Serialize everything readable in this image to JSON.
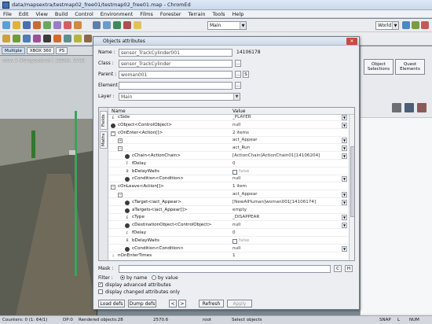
{
  "window": {
    "title": "data/mapsextra/testmap02_free01/testmap02_free01.map - ChromEd"
  },
  "menu": [
    "File",
    "Edit",
    "View",
    "Build",
    "Control",
    "Environment",
    "Films",
    "Forester",
    "Terrain",
    "Tools",
    "Help"
  ],
  "toolbar": {
    "main_combo": "Main",
    "world_combo": "World"
  },
  "platform_tabs": [
    "Multiple",
    "XBOX 360",
    "PS"
  ],
  "viewport": {
    "caption": "view 3 (Perspective) [ 29506, 5703"
  },
  "right_panel": {
    "object_selections": "Object Selections",
    "quest_elements": "Quest Elements"
  },
  "dialog": {
    "title": "Objects attributes",
    "name_label": "Name :",
    "name_value": "sensor_TrackCylinder001",
    "id_value": "14106178",
    "class_label": "Class :",
    "class_value": "sensor_TrackCylinder",
    "parent_label": "Parent :",
    "parent_value": "woman001",
    "parent_btn": "S",
    "element_label": "Element :",
    "layer_label": "Layer :",
    "layer_value": "Main",
    "vtab_fields": "Fields",
    "vtab_maths": "Maths",
    "col_name": "Name",
    "col_value": "Value",
    "rows": [
      {
        "icon": "E",
        "name": "cSide",
        "value": "_PLAYER",
        "dd": true,
        "indent": 0
      },
      {
        "icon": "obj",
        "name": "cObject<ControlObject>",
        "value": "null",
        "dd": true,
        "indent": 0
      },
      {
        "icon": "minus",
        "name": "cOnEnter<Action[]>",
        "value": "2 items",
        "dd": false,
        "indent": 0
      },
      {
        "icon": "plus",
        "name": "",
        "value": "act_Appear",
        "dd": true,
        "indent": 1
      },
      {
        "icon": "minus",
        "name": "",
        "value": "act_Run",
        "dd": true,
        "indent": 1
      },
      {
        "icon": "obj",
        "name": "cChain<ActionChain>",
        "value": "[ActionChain]ActionChain01[14106204]",
        "dd": true,
        "indent": 2
      },
      {
        "icon": "F",
        "name": "fDelay",
        "value": "0",
        "dd": false,
        "indent": 2
      },
      {
        "icon": "B",
        "name": "bDelayWaits",
        "value": "false",
        "dd": false,
        "chk": true,
        "indent": 2
      },
      {
        "icon": "obj",
        "name": "cCondition<Condition>",
        "value": "null",
        "dd": true,
        "indent": 2
      },
      {
        "icon": "minus",
        "name": "cOnLeave<Action[]>",
        "value": "1 item",
        "dd": false,
        "indent": 0
      },
      {
        "icon": "minus",
        "name": "",
        "value": "act_Appear",
        "dd": true,
        "indent": 1
      },
      {
        "icon": "obj",
        "name": "cTarget<iact_Appear>",
        "value": "[NewAIHuman]woman001[14106174]",
        "dd": true,
        "indent": 2
      },
      {
        "icon": "obj",
        "name": "aTargets<iact_Appear[]>",
        "value": "empty",
        "dd": false,
        "indent": 2
      },
      {
        "icon": "E",
        "name": "cType",
        "value": "_DISAPPEAR",
        "dd": true,
        "indent": 2
      },
      {
        "icon": "obj",
        "name": "cDestinationObject<ControlObject>",
        "value": "null",
        "dd": true,
        "indent": 2
      },
      {
        "icon": "F",
        "name": "fDelay",
        "value": "0",
        "dd": false,
        "indent": 2
      },
      {
        "icon": "B",
        "name": "bDelayWaits",
        "value": "false",
        "dd": false,
        "chk": true,
        "indent": 2
      },
      {
        "icon": "obj",
        "name": "cCondition<Condition>",
        "value": "null",
        "dd": true,
        "indent": 2
      },
      {
        "icon": "I",
        "name": "nOnEnterTimes",
        "value": "1",
        "dd": false,
        "indent": 0
      }
    ],
    "mask_label": "Mask :",
    "mask_btn_c": "C",
    "mask_btn_h": "H",
    "filter_label": "Filter :",
    "filter_by_name": "by name",
    "filter_by_value": "by value",
    "display_advanced": "display advanced attributes",
    "display_changed": "display changed attributes only",
    "load_defs": "Load defs",
    "dump_defs": "Dump defs",
    "refresh": "Refresh",
    "apply": "Apply"
  },
  "status": {
    "counters": "Counters: 0 (1: 64/1)",
    "dp": "DP:0",
    "rendered": "Rendered objects:28",
    "value1": "2570.6",
    "root": "root",
    "select": "Select objects",
    "snap": "SNAP",
    "l": "L",
    "num": "NUM"
  },
  "colors": {
    "title_bg": "#cdd9e8",
    "close": "#c94b3e",
    "grass": "#2e7a2c"
  }
}
